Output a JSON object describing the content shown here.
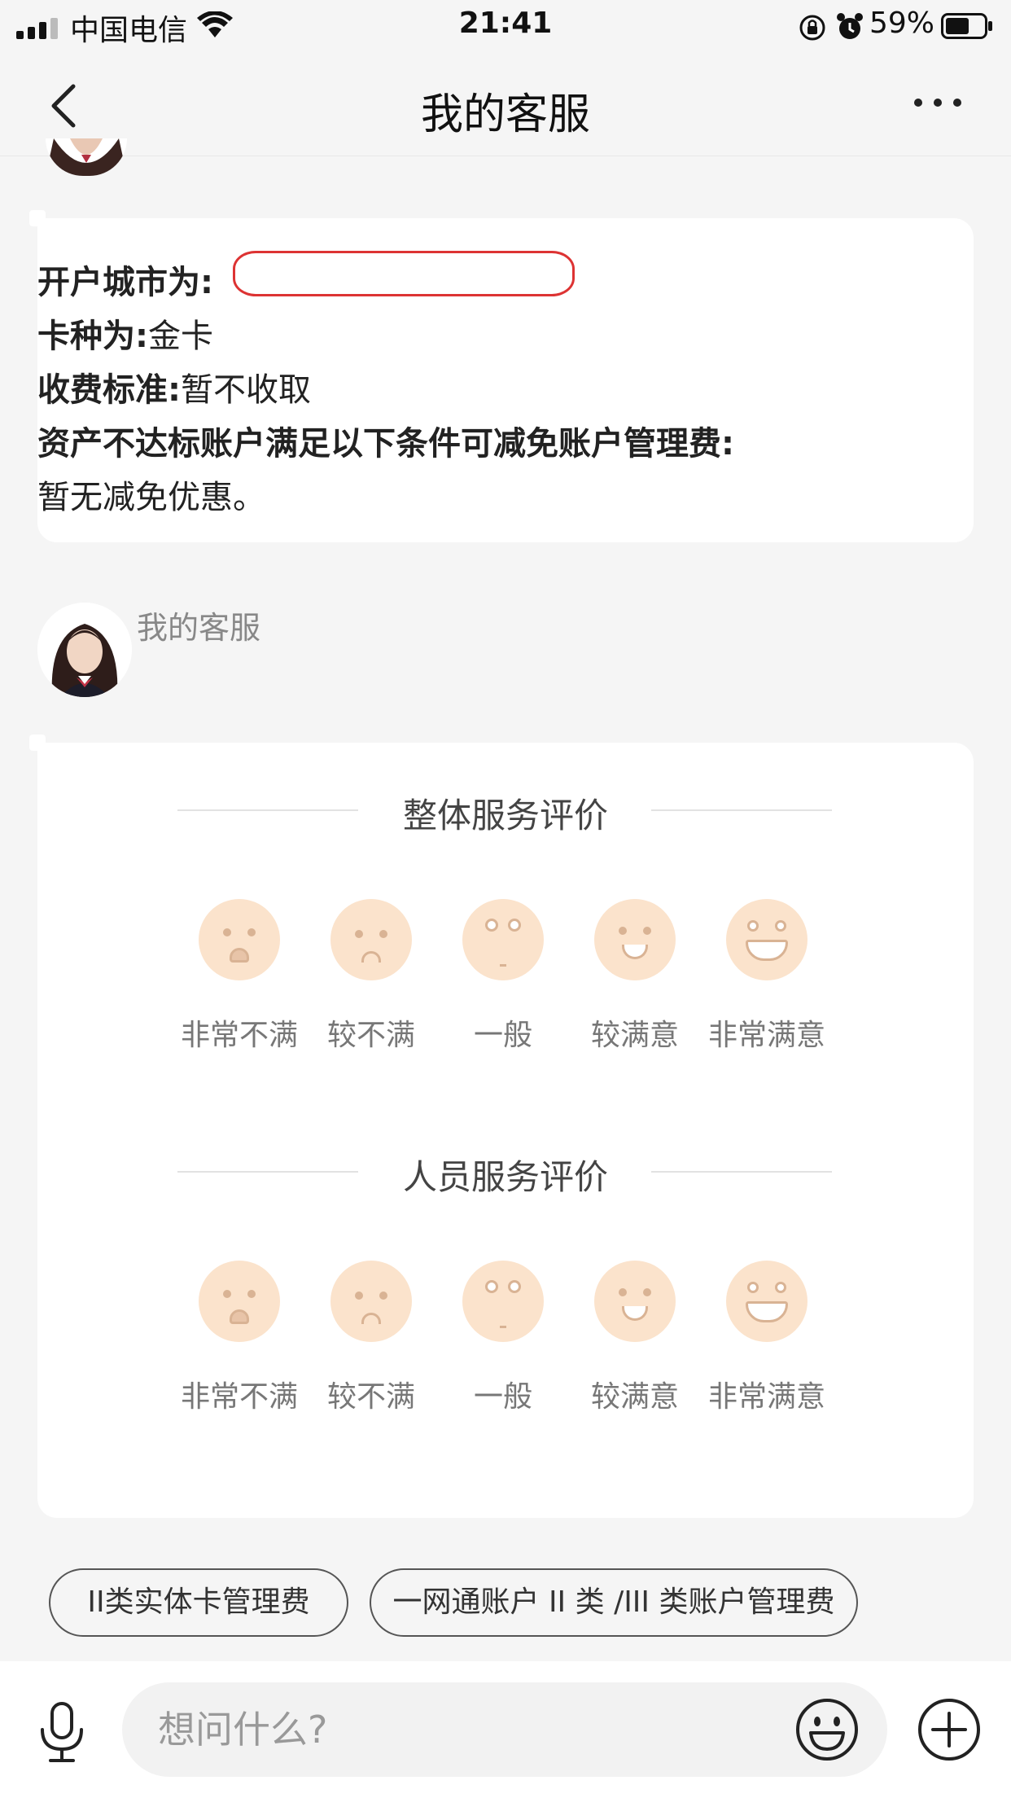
{
  "status_bar": {
    "carrier": "中国电信",
    "time": "21:41",
    "battery": "59%"
  },
  "nav": {
    "title": "我的客服"
  },
  "info_message": {
    "city_label": "开户城市为:",
    "card_label": "卡种为:",
    "card_value": "金卡",
    "fee_label": "收费标准:",
    "fee_value": "暂不收取",
    "waiver_label": "资产不达标账户满足以下条件可减免账户管理费:",
    "waiver_value": "暂无减免优惠。"
  },
  "agent": {
    "name": "我的客服"
  },
  "rating": {
    "overall_title": "整体服务评价",
    "staff_title": "人员服务评价",
    "options": [
      "非常不满",
      "较不满",
      "一般",
      "较满意",
      "非常满意"
    ]
  },
  "quick_replies": [
    "II类实体卡管理费",
    "一网通账户 II 类 /III 类账户管理费"
  ],
  "input": {
    "placeholder": "想问什么?"
  },
  "colors": {
    "face": "#fbe3cc",
    "redact_outline": "#dd3333"
  }
}
